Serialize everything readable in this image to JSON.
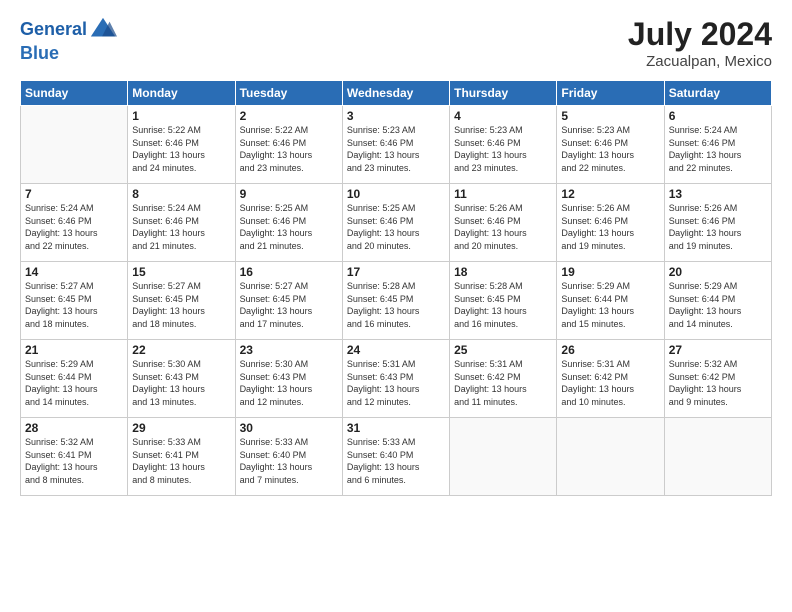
{
  "logo": {
    "line1": "General",
    "line2": "Blue"
  },
  "title": "July 2024",
  "subtitle": "Zacualpan, Mexico",
  "header_days": [
    "Sunday",
    "Monday",
    "Tuesday",
    "Wednesday",
    "Thursday",
    "Friday",
    "Saturday"
  ],
  "weeks": [
    [
      {
        "day": "",
        "info": ""
      },
      {
        "day": "1",
        "info": "Sunrise: 5:22 AM\nSunset: 6:46 PM\nDaylight: 13 hours\nand 24 minutes."
      },
      {
        "day": "2",
        "info": "Sunrise: 5:22 AM\nSunset: 6:46 PM\nDaylight: 13 hours\nand 23 minutes."
      },
      {
        "day": "3",
        "info": "Sunrise: 5:23 AM\nSunset: 6:46 PM\nDaylight: 13 hours\nand 23 minutes."
      },
      {
        "day": "4",
        "info": "Sunrise: 5:23 AM\nSunset: 6:46 PM\nDaylight: 13 hours\nand 23 minutes."
      },
      {
        "day": "5",
        "info": "Sunrise: 5:23 AM\nSunset: 6:46 PM\nDaylight: 13 hours\nand 22 minutes."
      },
      {
        "day": "6",
        "info": "Sunrise: 5:24 AM\nSunset: 6:46 PM\nDaylight: 13 hours\nand 22 minutes."
      }
    ],
    [
      {
        "day": "7",
        "info": "Sunrise: 5:24 AM\nSunset: 6:46 PM\nDaylight: 13 hours\nand 22 minutes."
      },
      {
        "day": "8",
        "info": "Sunrise: 5:24 AM\nSunset: 6:46 PM\nDaylight: 13 hours\nand 21 minutes."
      },
      {
        "day": "9",
        "info": "Sunrise: 5:25 AM\nSunset: 6:46 PM\nDaylight: 13 hours\nand 21 minutes."
      },
      {
        "day": "10",
        "info": "Sunrise: 5:25 AM\nSunset: 6:46 PM\nDaylight: 13 hours\nand 20 minutes."
      },
      {
        "day": "11",
        "info": "Sunrise: 5:26 AM\nSunset: 6:46 PM\nDaylight: 13 hours\nand 20 minutes."
      },
      {
        "day": "12",
        "info": "Sunrise: 5:26 AM\nSunset: 6:46 PM\nDaylight: 13 hours\nand 19 minutes."
      },
      {
        "day": "13",
        "info": "Sunrise: 5:26 AM\nSunset: 6:46 PM\nDaylight: 13 hours\nand 19 minutes."
      }
    ],
    [
      {
        "day": "14",
        "info": "Sunrise: 5:27 AM\nSunset: 6:45 PM\nDaylight: 13 hours\nand 18 minutes."
      },
      {
        "day": "15",
        "info": "Sunrise: 5:27 AM\nSunset: 6:45 PM\nDaylight: 13 hours\nand 18 minutes."
      },
      {
        "day": "16",
        "info": "Sunrise: 5:27 AM\nSunset: 6:45 PM\nDaylight: 13 hours\nand 17 minutes."
      },
      {
        "day": "17",
        "info": "Sunrise: 5:28 AM\nSunset: 6:45 PM\nDaylight: 13 hours\nand 16 minutes."
      },
      {
        "day": "18",
        "info": "Sunrise: 5:28 AM\nSunset: 6:45 PM\nDaylight: 13 hours\nand 16 minutes."
      },
      {
        "day": "19",
        "info": "Sunrise: 5:29 AM\nSunset: 6:44 PM\nDaylight: 13 hours\nand 15 minutes."
      },
      {
        "day": "20",
        "info": "Sunrise: 5:29 AM\nSunset: 6:44 PM\nDaylight: 13 hours\nand 14 minutes."
      }
    ],
    [
      {
        "day": "21",
        "info": "Sunrise: 5:29 AM\nSunset: 6:44 PM\nDaylight: 13 hours\nand 14 minutes."
      },
      {
        "day": "22",
        "info": "Sunrise: 5:30 AM\nSunset: 6:43 PM\nDaylight: 13 hours\nand 13 minutes."
      },
      {
        "day": "23",
        "info": "Sunrise: 5:30 AM\nSunset: 6:43 PM\nDaylight: 13 hours\nand 12 minutes."
      },
      {
        "day": "24",
        "info": "Sunrise: 5:31 AM\nSunset: 6:43 PM\nDaylight: 13 hours\nand 12 minutes."
      },
      {
        "day": "25",
        "info": "Sunrise: 5:31 AM\nSunset: 6:42 PM\nDaylight: 13 hours\nand 11 minutes."
      },
      {
        "day": "26",
        "info": "Sunrise: 5:31 AM\nSunset: 6:42 PM\nDaylight: 13 hours\nand 10 minutes."
      },
      {
        "day": "27",
        "info": "Sunrise: 5:32 AM\nSunset: 6:42 PM\nDaylight: 13 hours\nand 9 minutes."
      }
    ],
    [
      {
        "day": "28",
        "info": "Sunrise: 5:32 AM\nSunset: 6:41 PM\nDaylight: 13 hours\nand 8 minutes."
      },
      {
        "day": "29",
        "info": "Sunrise: 5:33 AM\nSunset: 6:41 PM\nDaylight: 13 hours\nand 8 minutes."
      },
      {
        "day": "30",
        "info": "Sunrise: 5:33 AM\nSunset: 6:40 PM\nDaylight: 13 hours\nand 7 minutes."
      },
      {
        "day": "31",
        "info": "Sunrise: 5:33 AM\nSunset: 6:40 PM\nDaylight: 13 hours\nand 6 minutes."
      },
      {
        "day": "",
        "info": ""
      },
      {
        "day": "",
        "info": ""
      },
      {
        "day": "",
        "info": ""
      }
    ]
  ]
}
